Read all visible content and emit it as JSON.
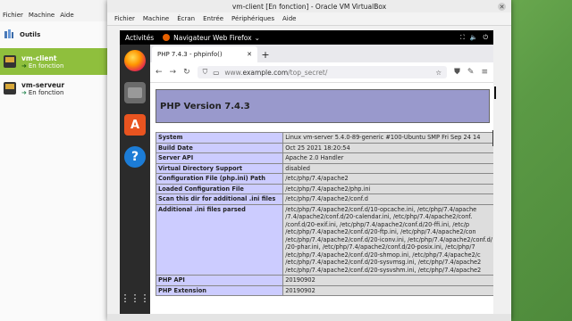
{
  "manager": {
    "menu": [
      "Fichier",
      "Machine",
      "Aide"
    ],
    "tools_label": "Outils",
    "vms": [
      {
        "name": "vm-client",
        "state": "En fonction",
        "selected": true
      },
      {
        "name": "vm-serveur",
        "state": "En fonction",
        "selected": false
      }
    ]
  },
  "vmwindow": {
    "title": "vm-client [En fonction] - Oracle VM VirtualBox",
    "menu": [
      "Fichier",
      "Machine",
      "Écran",
      "Entrée",
      "Périphériques",
      "Aide"
    ]
  },
  "gnome": {
    "activities": "Activités",
    "app_label": "Navigateur Web Firefox",
    "app_chevron": "⌄"
  },
  "firefox": {
    "tab_title": "PHP 7.4.3 - phpinfo()",
    "url_prefix": "www.",
    "url_host": "example.com",
    "url_path": "/top_secret/"
  },
  "phpinfo": {
    "header": "PHP Version 7.4.3",
    "rows": [
      {
        "k": "System",
        "v": [
          "Linux vm-server 5.4.0-89-generic #100-Ubuntu SMP Fri Sep 24 14"
        ]
      },
      {
        "k": "Build Date",
        "v": [
          "Oct 25 2021 18:20:54"
        ]
      },
      {
        "k": "Server API",
        "v": [
          "Apache 2.0 Handler"
        ]
      },
      {
        "k": "Virtual Directory Support",
        "v": [
          "disabled"
        ]
      },
      {
        "k": "Configuration File (php.ini) Path",
        "v": [
          "/etc/php/7.4/apache2"
        ]
      },
      {
        "k": "Loaded Configuration File",
        "v": [
          "/etc/php/7.4/apache2/php.ini"
        ]
      },
      {
        "k": "Scan this dir for additional .ini files",
        "v": [
          "/etc/php/7.4/apache2/conf.d"
        ]
      },
      {
        "k": "Additional .ini files parsed",
        "v": [
          "/etc/php/7.4/apache2/conf.d/10-opcache.ini, /etc/php/7.4/apache",
          "/7.4/apache2/conf.d/20-calendar.ini, /etc/php/7.4/apache2/conf.",
          "/conf.d/20-exif.ini, /etc/php/7.4/apache2/conf.d/20-ffi.ini, /etc/p",
          "/etc/php/7.4/apache2/conf.d/20-ftp.ini, /etc/php/7.4/apache2/con",
          "/etc/php/7.4/apache2/conf.d/20-iconv.ini, /etc/php/7.4/apache2/conf.d/",
          "/20-phar.ini, /etc/php/7.4/apache2/conf.d/20-posix.ini, /etc/php/7",
          "/etc/php/7.4/apache2/conf.d/20-shmop.ini, /etc/php/7.4/apache2/c",
          "/etc/php/7.4/apache2/conf.d/20-sysvmsg.ini, /etc/php/7.4/apache2",
          "/etc/php/7.4/apache2/conf.d/20-sysvshm.ini, /etc/php/7.4/apache2"
        ]
      },
      {
        "k": "PHP API",
        "v": [
          "20190902"
        ]
      },
      {
        "k": "PHP Extension",
        "v": [
          "20190902"
        ]
      }
    ]
  }
}
